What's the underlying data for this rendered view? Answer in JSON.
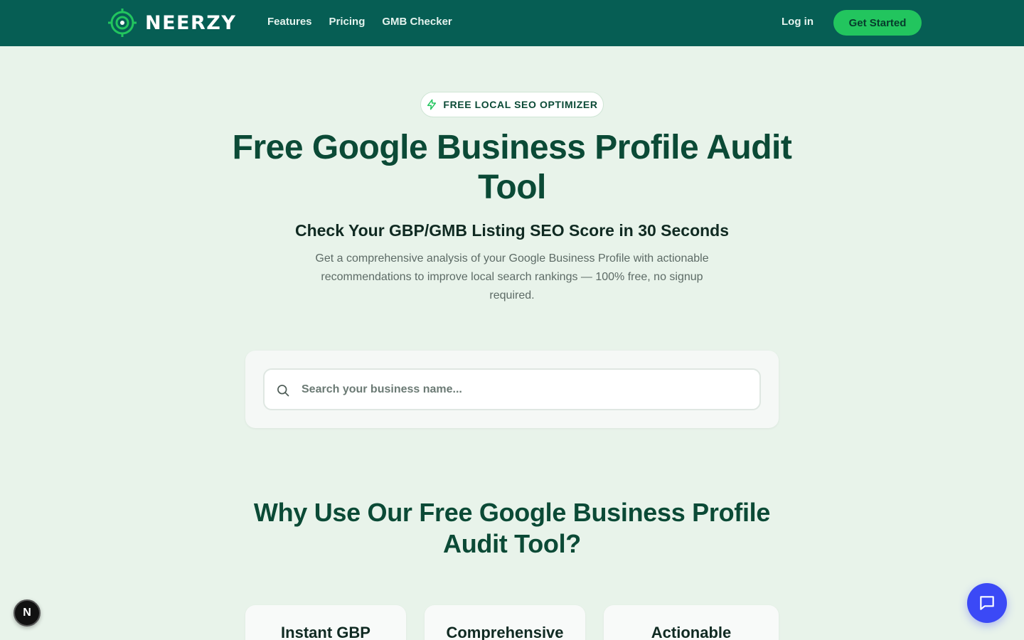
{
  "header": {
    "brand": "NEERZY",
    "nav": [
      "Features",
      "Pricing",
      "GMB Checker"
    ],
    "login_label": "Log in",
    "cta_label": "Get Started"
  },
  "hero": {
    "badge": "FREE LOCAL SEO OPTIMIZER",
    "title": "Free Google Business Profile Audit Tool",
    "subtitle": "Check Your GBP/GMB Listing SEO Score in 30 Seconds",
    "description": "Get a comprehensive analysis of your Google Business Profile with actionable recommendations to improve local search rankings — 100% free, no signup required."
  },
  "search": {
    "placeholder": "Search your business name..."
  },
  "why": {
    "title": "Why Use Our Free Google Business Profile Audit Tool?",
    "cards": [
      "Instant GBP",
      "Comprehensive",
      "Actionable"
    ]
  },
  "widgets": {
    "next_badge": "N",
    "chat_icon": "chat-bubble-icon"
  },
  "colors": {
    "nav_bg": "#065e54",
    "accent": "#22c55e",
    "heading": "#0b4a36",
    "page_bg": "#e8f3ea",
    "chat": "#3b49f6"
  }
}
